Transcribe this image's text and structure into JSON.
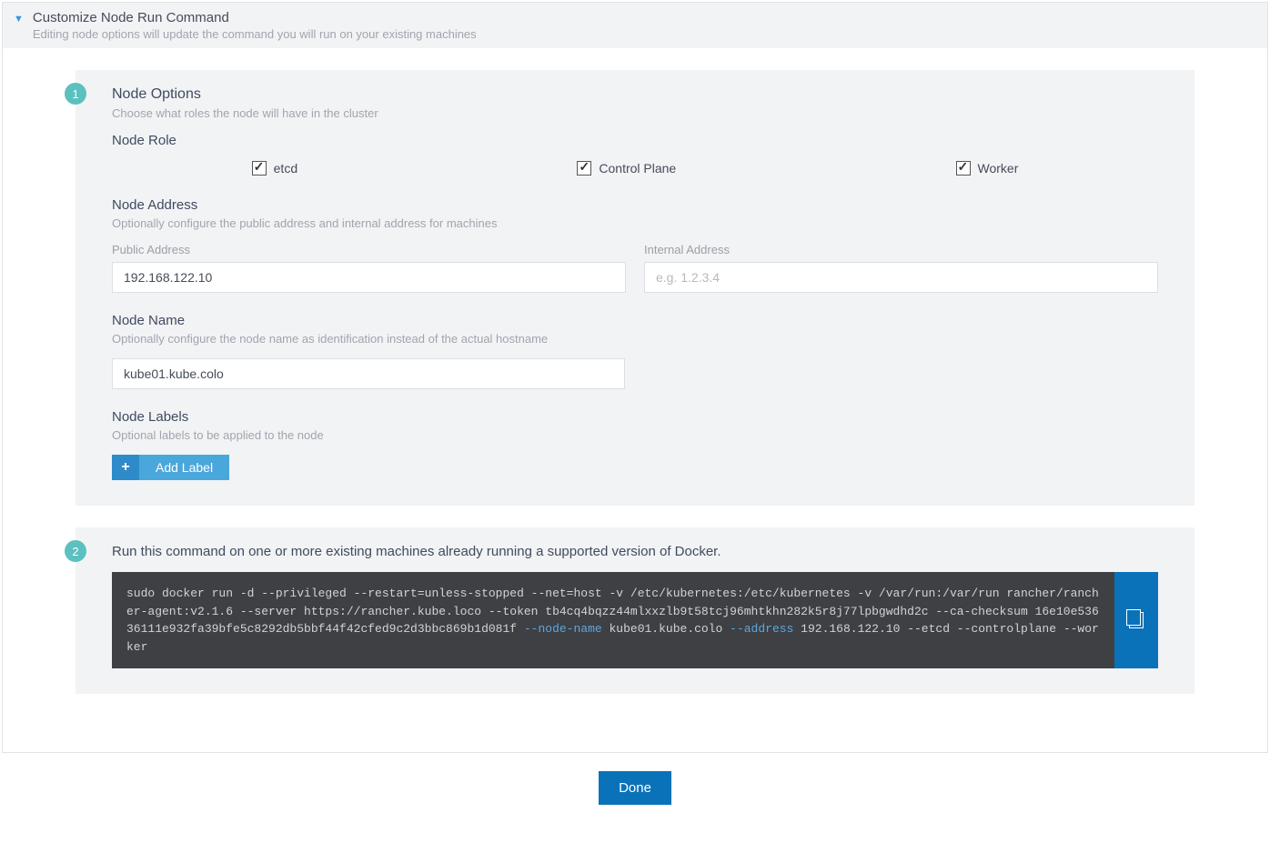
{
  "header": {
    "title": "Customize Node Run Command",
    "subtitle": "Editing node options will update the command you will run on your existing machines"
  },
  "step1": {
    "badge": "1",
    "title": "Node Options",
    "subtitle": "Choose what roles the node will have in the cluster",
    "node_role_label": "Node Role",
    "roles": {
      "etcd": "etcd",
      "control_plane": "Control Plane",
      "worker": "Worker"
    },
    "node_address": {
      "title": "Node Address",
      "subtitle": "Optionally configure the public address and internal address for machines",
      "public_label": "Public Address",
      "public_value": "192.168.122.10",
      "internal_label": "Internal Address",
      "internal_placeholder": "e.g. 1.2.3.4"
    },
    "node_name": {
      "title": "Node Name",
      "subtitle": "Optionally configure the node name as identification instead of the actual hostname",
      "value": "kube01.kube.colo"
    },
    "node_labels": {
      "title": "Node Labels",
      "subtitle": "Optional labels to be applied to the node",
      "add_label": "Add Label"
    }
  },
  "step2": {
    "badge": "2",
    "title": "Run this command on one or more existing machines already running a supported version of Docker.",
    "cmd_p1": "sudo docker run -d --privileged --restart=unless-stopped --net=host -v /etc/kubernetes:/etc/kubernetes -v /var/run:/var/run rancher/rancher-agent:v2.1.6 --server https://rancher.kube.loco --token tb4cq4bqzz44mlxxzlb9t58tcj96mhtkhn282k5r8j77lpbgwdhd2c --ca-checksum 16e10e53636111e932fa39bfe5c8292db5bbf44f42cfed9c2d3bbc869b1d081f ",
    "cmd_nodename_flag": "--node-name",
    "cmd_nodename_val": " kube01.kube.colo ",
    "cmd_address_flag": "--address",
    "cmd_address_val": " 192.168.122.10 ",
    "cmd_tail": "--etcd --controlplane --worker"
  },
  "footer": {
    "done": "Done"
  }
}
